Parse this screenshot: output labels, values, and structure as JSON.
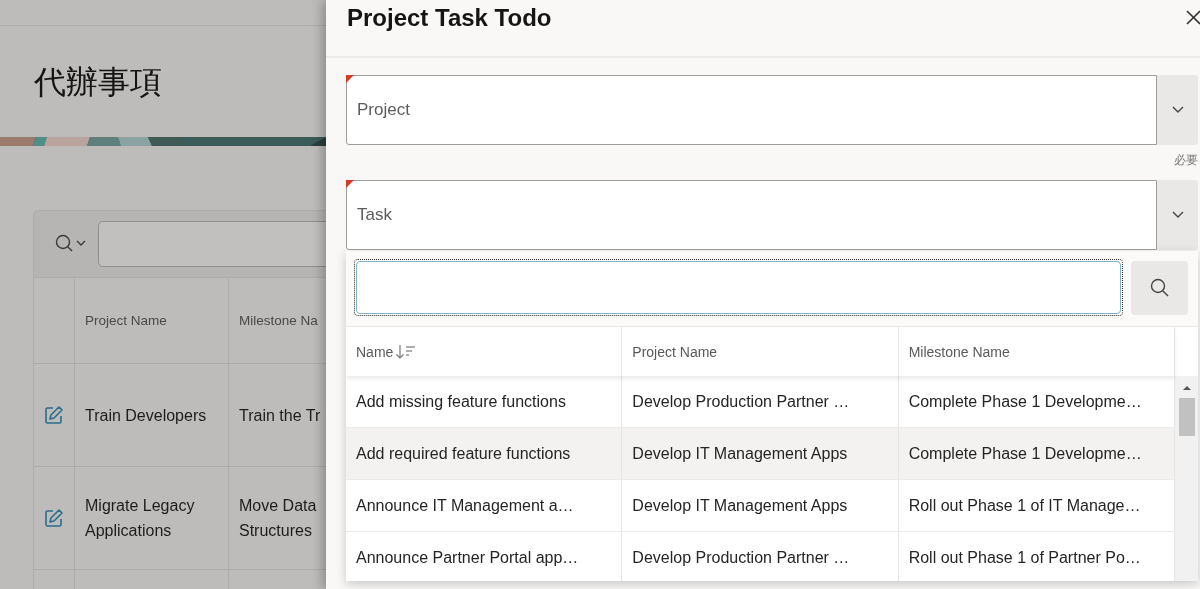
{
  "page": {
    "title": "代辦事項",
    "report": {
      "columns": [
        "Project Name",
        "Milestone Na"
      ],
      "rows": [
        {
          "project_name": "Train Developers",
          "milestone": "Train the Tr"
        },
        {
          "project_name": "Migrate Legacy Applications",
          "milestone": "Move Data Structures"
        }
      ]
    }
  },
  "drawer": {
    "title": "Project Task Todo",
    "fields": [
      {
        "label": "Project",
        "required": true,
        "note": "必要"
      },
      {
        "label": "Task",
        "required": true
      }
    ],
    "popup": {
      "columns": [
        {
          "label": "Name",
          "sorted": true
        },
        {
          "label": "Project Name",
          "sorted": false
        },
        {
          "label": "Milestone Name",
          "sorted": false
        }
      ],
      "rows": [
        {
          "cells": [
            "Add missing feature functions",
            "Develop Production Partner …",
            "Complete Phase 1 Developme…"
          ],
          "selected": false
        },
        {
          "cells": [
            "Add required feature functions",
            "Develop IT Management Apps",
            "Complete Phase 1 Developme…"
          ],
          "selected": true
        },
        {
          "cells": [
            "Announce IT Management a…",
            "Develop IT Management Apps",
            "Roll out Phase 1 of IT Manage…"
          ],
          "selected": false
        },
        {
          "cells": [
            "Announce Partner Portal app…",
            "Develop Production Partner …",
            "Roll out Phase 1 of Partner Po…"
          ],
          "selected": false
        }
      ]
    }
  }
}
